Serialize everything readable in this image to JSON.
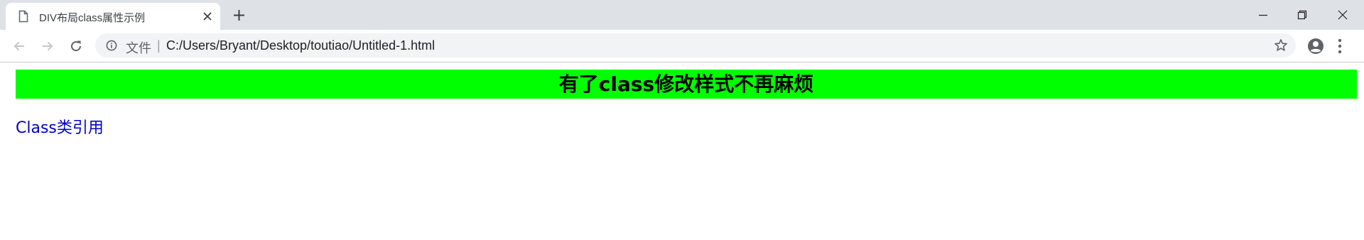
{
  "browser": {
    "tab": {
      "title": "DIV布局class属性示例"
    },
    "omnibox": {
      "security_label": "文件",
      "separator": "|",
      "url": "C:/Users/Bryant/Desktop/toutiao/Untitled-1.html"
    },
    "icons": {
      "favicon": "page-icon",
      "close": "close-icon",
      "new_tab": "plus-icon",
      "back": "arrow-left-icon",
      "forward": "arrow-right-icon",
      "reload": "reload-icon",
      "info": "info-icon",
      "star": "star-icon",
      "profile": "account-circle-icon",
      "menu": "vertical-dots-icon",
      "minimize": "minimize-icon",
      "restore": "restore-icon",
      "window_close": "window-close-icon"
    }
  },
  "page": {
    "banner": {
      "text": "有了class修改样式不再麻烦",
      "background": "#00ff00"
    },
    "link": {
      "text": "Class类引用",
      "color": "#0000cc"
    }
  }
}
